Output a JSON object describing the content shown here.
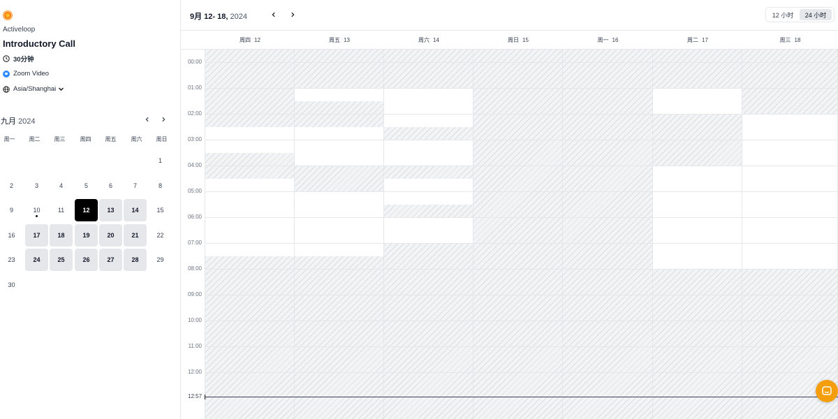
{
  "sidebar": {
    "org_name": "Activeloop",
    "event_title": "Introductory Call",
    "duration": "30分钟",
    "location": "Zoom Video",
    "timezone": "Asia/Shanghai",
    "month_name": "九月",
    "year": "2024",
    "weekdays": [
      "周一",
      "周二",
      "周三",
      "周四",
      "周五",
      "周六",
      "周日"
    ],
    "selected_day": "12",
    "today_marker_day": "10"
  },
  "header": {
    "date_range": "9月 12- 18,",
    "year": "2024",
    "toggle_12": "12 小时",
    "toggle_24": "24 小时",
    "active_format": "24 小时"
  },
  "week": {
    "days": [
      {
        "weekday": "周四",
        "date": "12"
      },
      {
        "weekday": "周五",
        "date": "13"
      },
      {
        "weekday": "周六",
        "date": "14"
      },
      {
        "weekday": "周日",
        "date": "15"
      },
      {
        "weekday": "周一",
        "date": "16"
      },
      {
        "weekday": "周二",
        "date": "17"
      },
      {
        "weekday": "周三",
        "date": "18"
      }
    ],
    "hours": [
      "00:00",
      "01:00",
      "02:00",
      "03:00",
      "04:00",
      "05:00",
      "06:00",
      "07:00",
      "08:00",
      "09:00",
      "10:00",
      "11:00",
      "12:00"
    ],
    "current_time": "12:57",
    "available_slots": [
      [
        [
          "02:30",
          "03:30"
        ],
        [
          "04:30",
          "07:30"
        ]
      ],
      [
        [
          "01:00",
          "01:30"
        ],
        [
          "02:30",
          "04:00"
        ],
        [
          "05:00",
          "07:30"
        ]
      ],
      [
        [
          "01:00",
          "02:30"
        ],
        [
          "03:00",
          "04:00"
        ],
        [
          "04:30",
          "05:30"
        ],
        [
          "06:00",
          "07:00"
        ]
      ],
      [],
      [],
      [
        [
          "01:00",
          "02:00"
        ],
        [
          "04:00",
          "08:00"
        ]
      ],
      [
        [
          "02:00",
          "08:00"
        ]
      ]
    ]
  },
  "colors": {
    "selected_day_bg": "#000000",
    "available_day_bg": "#e5e7eb",
    "chat_button": "#f59e0b",
    "zoom_blue": "#2d8cff"
  }
}
